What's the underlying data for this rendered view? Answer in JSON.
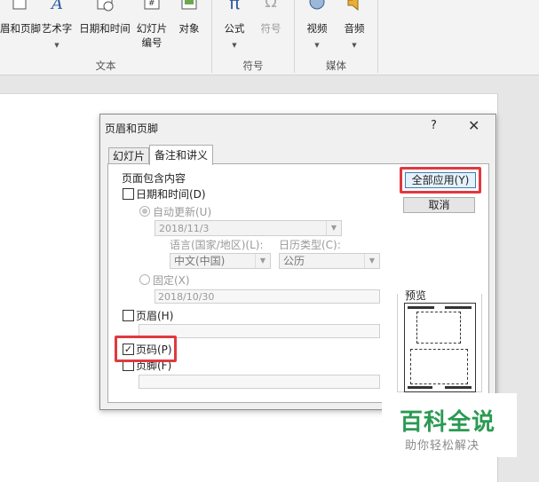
{
  "ribbon": {
    "header_footer": "眉和页脚",
    "wordart": "艺术字",
    "datetime": "日期和时间",
    "slide_number_line1": "幻灯片",
    "slide_number_line2": "编号",
    "object": "对象",
    "equation": "公式",
    "symbol": "符号",
    "video": "视频",
    "audio": "音频",
    "group_text": "文本",
    "group_symbols": "符号",
    "group_media": "媒体",
    "equation_glyph": "π",
    "symbol_glyph": "Ω"
  },
  "dialog": {
    "title": "页眉和页脚",
    "help": "?",
    "close": "✕",
    "tabs": [
      "幻灯片",
      "备注和讲义"
    ],
    "group_label": "页面包含内容",
    "datetime_label": "日期和时间(D)",
    "auto_update_label": "自动更新(U)",
    "auto_date": "2018/11/3",
    "language_label": "语言(国家/地区)(L):",
    "calendar_label": "日历类型(C):",
    "language_value": "中文(中国)",
    "calendar_value": "公历",
    "fixed_label": "固定(X)",
    "fixed_date": "2018/10/30",
    "header_label": "页眉(H)",
    "page_number_label": "页码(P)",
    "footer_label": "页脚(F)",
    "page_number_checked": true,
    "check_mark": "✓",
    "apply_all": "全部应用(Y)",
    "cancel": "取消",
    "preview_label": "预览"
  },
  "watermark": {
    "main": "百科全说",
    "sub": "助你轻松解决"
  },
  "colors": {
    "highlight": "#e0393f",
    "watermark_green": "#2a9a52"
  }
}
